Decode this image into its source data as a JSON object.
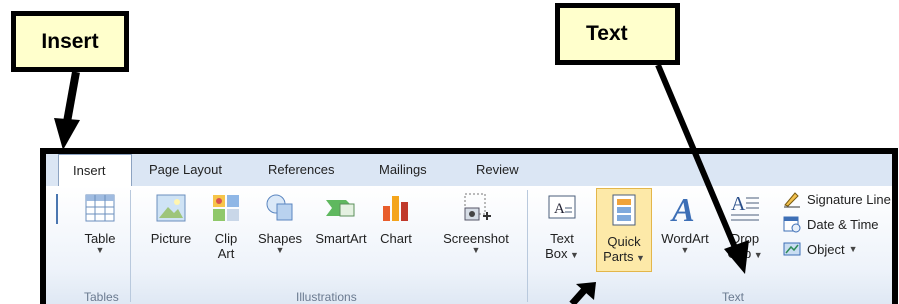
{
  "callouts": {
    "insert": "Insert",
    "text": "Text"
  },
  "tabs": [
    "Insert",
    "Page Layout",
    "References",
    "Mailings",
    "Review"
  ],
  "groups": {
    "tables": "Tables",
    "illustrations": "Illustrations",
    "text": "Text"
  },
  "buttons": {
    "table": "Table",
    "picture": "Picture",
    "clip_art_1": "Clip",
    "clip_art_2": "Art",
    "shapes": "Shapes",
    "smartart": "SmartArt",
    "chart": "Chart",
    "screenshot": "Screenshot",
    "text_box_1": "Text",
    "text_box_2": "Box",
    "quick_parts_1": "Quick",
    "quick_parts_2": "Parts",
    "wordart": "WordArt",
    "drop_cap_1": "Drop",
    "drop_cap_2": "Cap",
    "signature_line": "Signature Line",
    "date_time": "Date & Time",
    "object": "Object"
  },
  "colors": {
    "callout_bg": "#ffffcc",
    "highlight": "#fde9a8",
    "ribbon_bg": "#dfe9f5"
  },
  "icons": [
    "table-icon",
    "picture-icon",
    "clip-art-icon",
    "shapes-icon",
    "smartart-icon",
    "chart-icon",
    "screenshot-icon",
    "text-box-icon",
    "quick-parts-icon",
    "wordart-icon",
    "drop-cap-icon",
    "signature-line-icon",
    "date-time-icon",
    "object-icon"
  ]
}
